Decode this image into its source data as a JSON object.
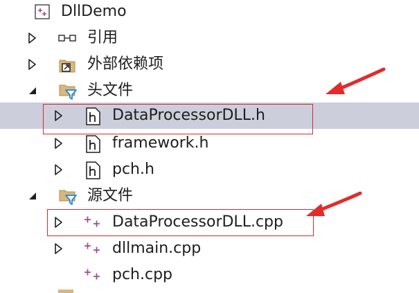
{
  "tree": {
    "project": {
      "label": "DllDemo",
      "icon": "cpp-project-icon"
    },
    "references": {
      "label": "引用",
      "icon": "references-icon"
    },
    "external": {
      "label": "外部依赖项",
      "icon": "external-dependencies-icon"
    },
    "headers": {
      "label": "头文件",
      "icon": "filter-folder-icon",
      "items": [
        {
          "label": "DataProcessorDLL.h",
          "icon": "header-file-icon"
        },
        {
          "label": "framework.h",
          "icon": "header-file-icon"
        },
        {
          "label": "pch.h",
          "icon": "header-file-icon"
        }
      ]
    },
    "sources": {
      "label": "源文件",
      "icon": "filter-folder-icon",
      "items": [
        {
          "label": "DataProcessorDLL.cpp",
          "icon": "cpp-file-icon"
        },
        {
          "label": "dllmain.cpp",
          "icon": "cpp-file-icon"
        },
        {
          "label": "pch.cpp",
          "icon": "cpp-file-icon"
        }
      ]
    }
  },
  "colors": {
    "selection": "#cccedb",
    "annotation": "#e52a2a",
    "folder": "#dcb67a",
    "filter": "#1f88d8",
    "cpp": "#9b4f96"
  }
}
